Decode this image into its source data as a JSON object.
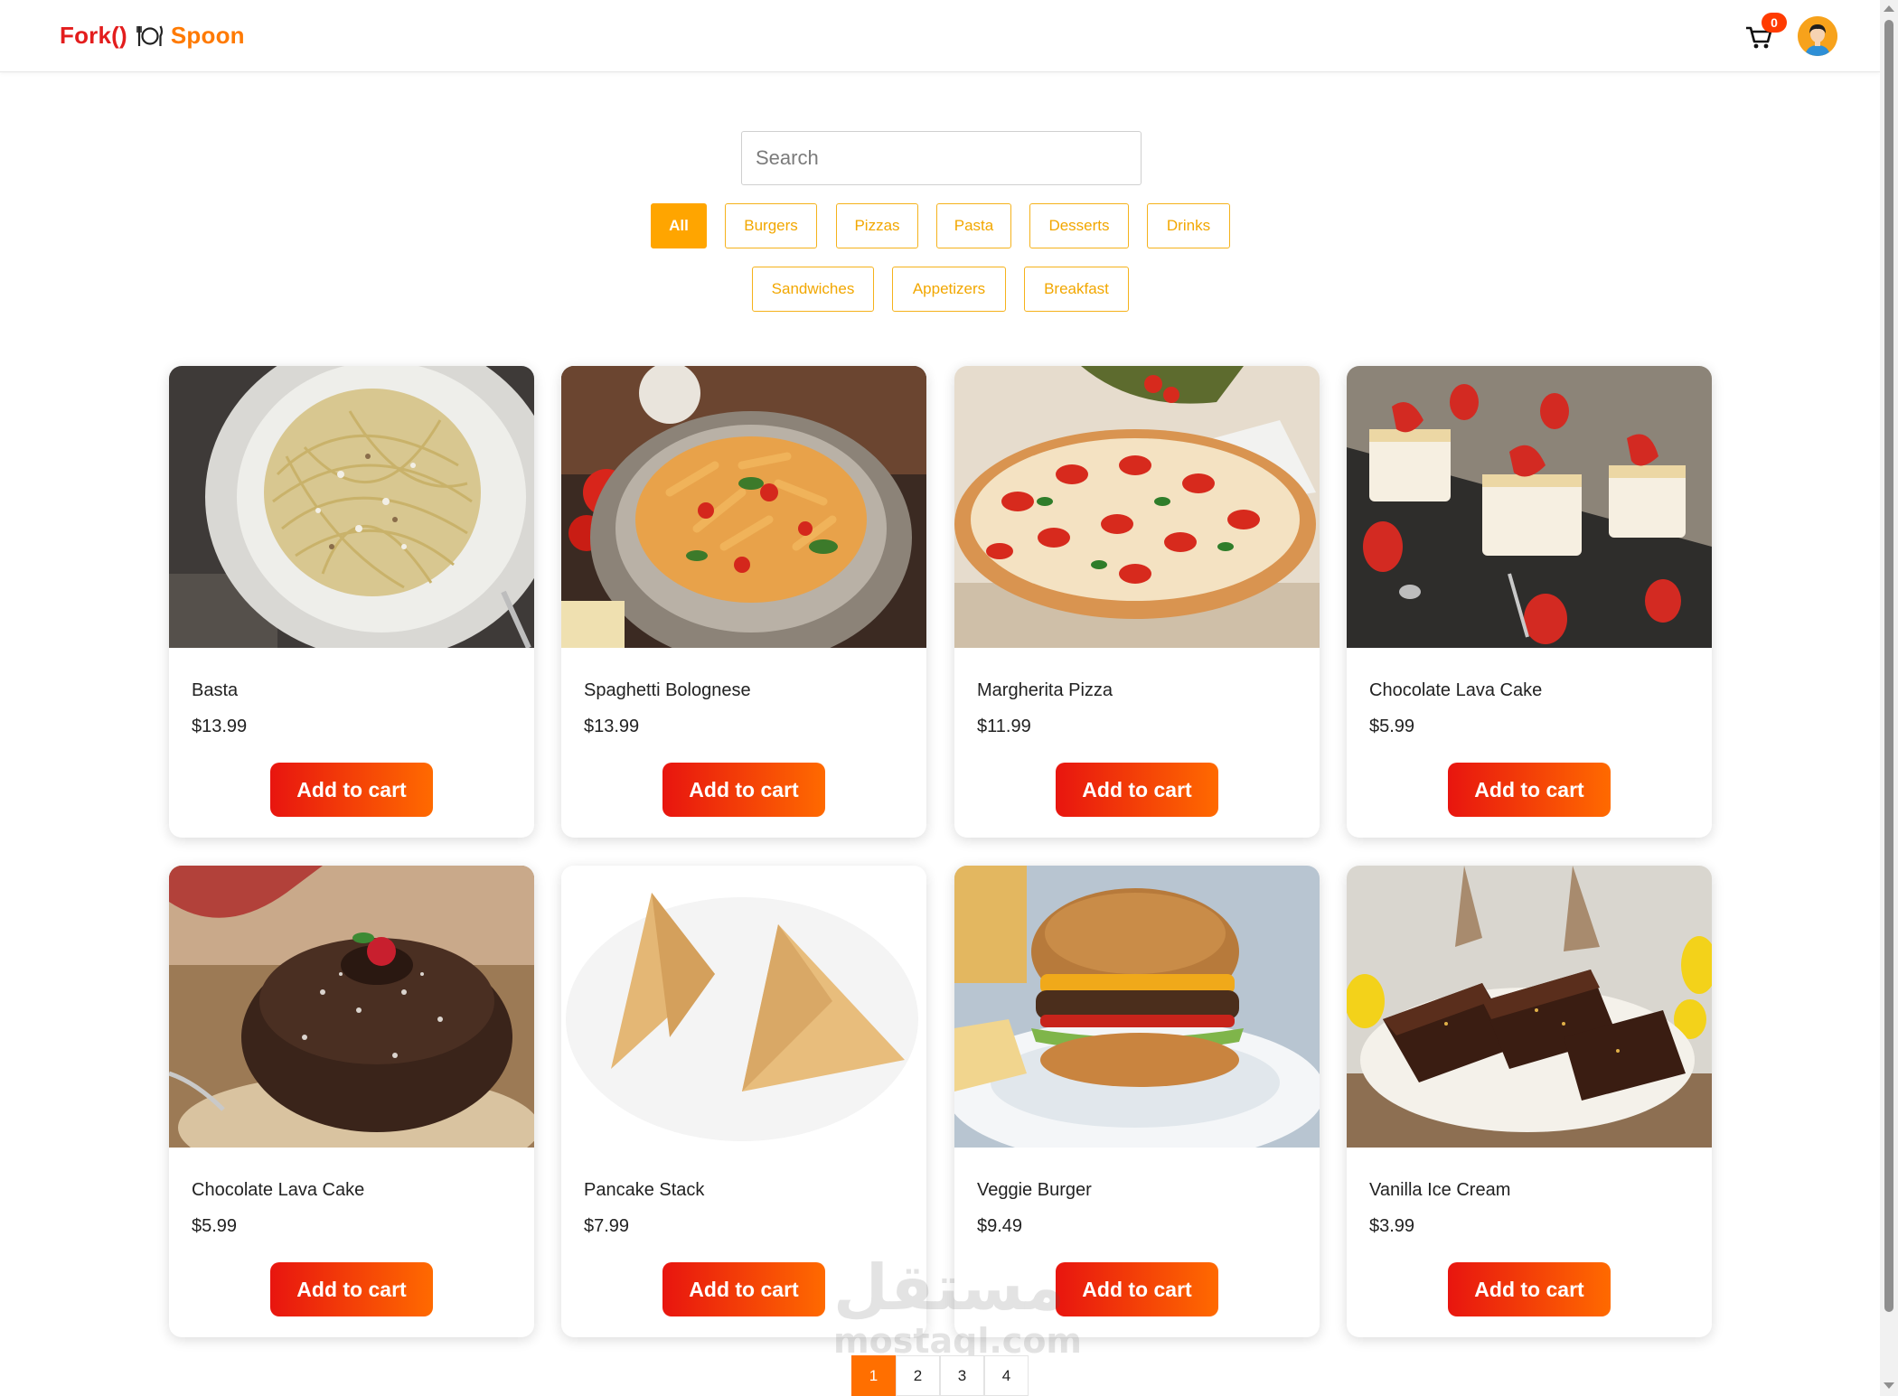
{
  "header": {
    "logo_left": "Fork()",
    "logo_right": "Spoon",
    "cart_count": "0"
  },
  "search": {
    "placeholder": "Search",
    "value": ""
  },
  "filters": [
    "All",
    "Burgers",
    "Pizzas",
    "Pasta",
    "Desserts",
    "Drinks",
    "Sandwiches",
    "Appetizers",
    "Breakfast"
  ],
  "active_filter": "All",
  "products": [
    {
      "name": "Basta",
      "price": "$13.99",
      "button": "Add to cart",
      "image": "pasta-image"
    },
    {
      "name": "Spaghetti Bolognese",
      "price": "$13.99",
      "button": "Add to cart",
      "image": "penne-image"
    },
    {
      "name": "Margherita Pizza",
      "price": "$11.99",
      "button": "Add to cart",
      "image": "pizza-image"
    },
    {
      "name": "Chocolate Lava Cake",
      "price": "$5.99",
      "button": "Add to cart",
      "image": "strawberry-cake-image"
    },
    {
      "name": "Chocolate Lava Cake",
      "price": "$5.99",
      "button": "Add to cart",
      "image": "chocolate-cake-image"
    },
    {
      "name": "Pancake Stack",
      "price": "$7.99",
      "button": "Add to cart",
      "image": "samosa-image"
    },
    {
      "name": "Veggie Burger",
      "price": "$9.49",
      "button": "Add to cart",
      "image": "burger-image"
    },
    {
      "name": "Vanilla Ice Cream",
      "price": "$3.99",
      "button": "Add to cart",
      "image": "brownie-image"
    }
  ],
  "pagination": {
    "pages": [
      "1",
      "2",
      "3",
      "4"
    ],
    "current": "1"
  },
  "watermark": {
    "arabic": "مستقل",
    "latin": "mostaql.com"
  },
  "colors": {
    "primary": "#e8150f",
    "accent": "#ff6a00",
    "filter": "#ffa500"
  }
}
